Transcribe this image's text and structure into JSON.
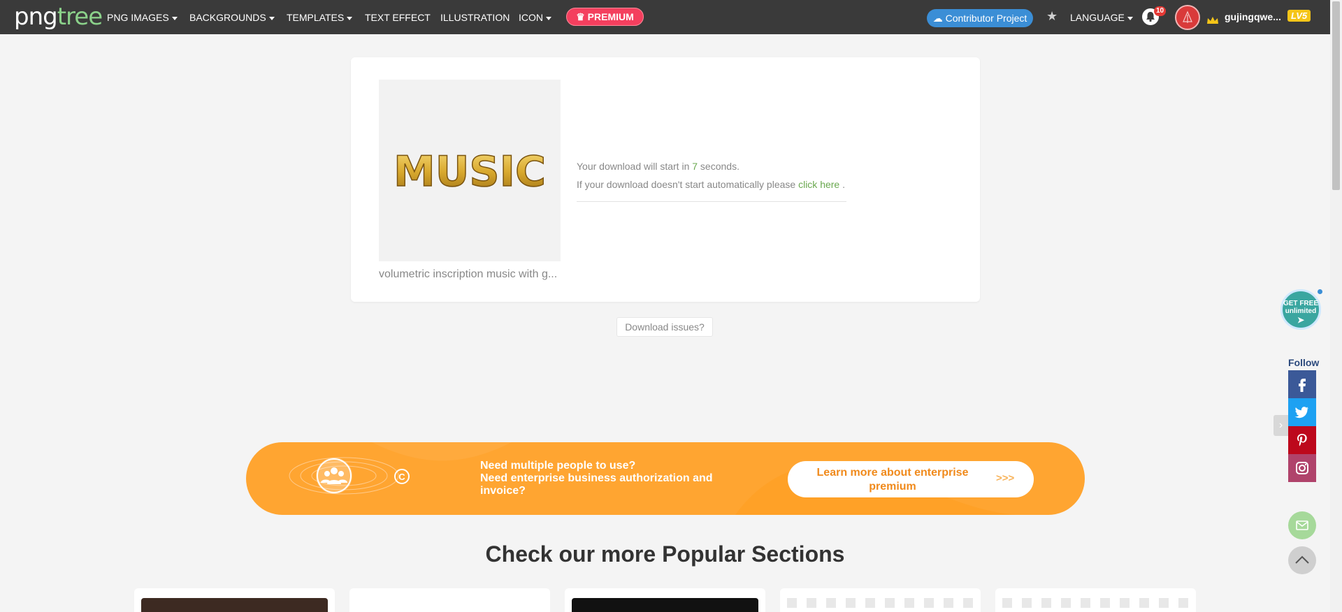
{
  "header": {
    "logo_part1": "png",
    "logo_part2": "tree",
    "nav": [
      {
        "label": "PNG IMAGES"
      },
      {
        "label": "BACKGROUNDS"
      },
      {
        "label": "TEMPLATES"
      },
      {
        "label": "TEXT EFFECT"
      },
      {
        "label": "ILLUSTRATION"
      },
      {
        "label": "ICON"
      }
    ],
    "premium_label": "PREMIUM",
    "contributor_label": "Contributor Project",
    "language_label": "LANGUAGE",
    "notification_count": "10",
    "username": "gujingqwe...",
    "level": "LV5"
  },
  "download": {
    "thumbnail_word": "MUSIC",
    "thumbnail_title": "volumetric inscription music with g...",
    "countdown_prefix": "Your download will start in ",
    "countdown_seconds": "7",
    "countdown_suffix": " seconds.",
    "fallback_prefix": "If your download doesn't start automatically please ",
    "fallback_link": "click here",
    "fallback_suffix": " .",
    "issues_label": "Download issues?"
  },
  "enterprise": {
    "line1": "Need multiple people to use?",
    "line2": "Need enterprise business authorization and invoice?",
    "button_label": "Learn more about enterprise premium",
    "button_arrows": ">>>"
  },
  "popular": {
    "title": "Check our more Popular Sections"
  },
  "sidebar": {
    "get_free_line1": "GET FREE",
    "get_free_line2": "unlimited",
    "follow_label": "Follow",
    "social": [
      {
        "name": "facebook",
        "color": "#3b5998"
      },
      {
        "name": "twitter",
        "color": "#1da1f2"
      },
      {
        "name": "pinterest",
        "color": "#bd081c"
      },
      {
        "name": "instagram",
        "color": "#b0436b"
      }
    ]
  },
  "colors": {
    "nav_bg": "#3a3a3a",
    "premium": "#f43f5e",
    "contributor": "#3b8ed6",
    "banner": "#ffa531",
    "link_green": "#6aa84f"
  }
}
